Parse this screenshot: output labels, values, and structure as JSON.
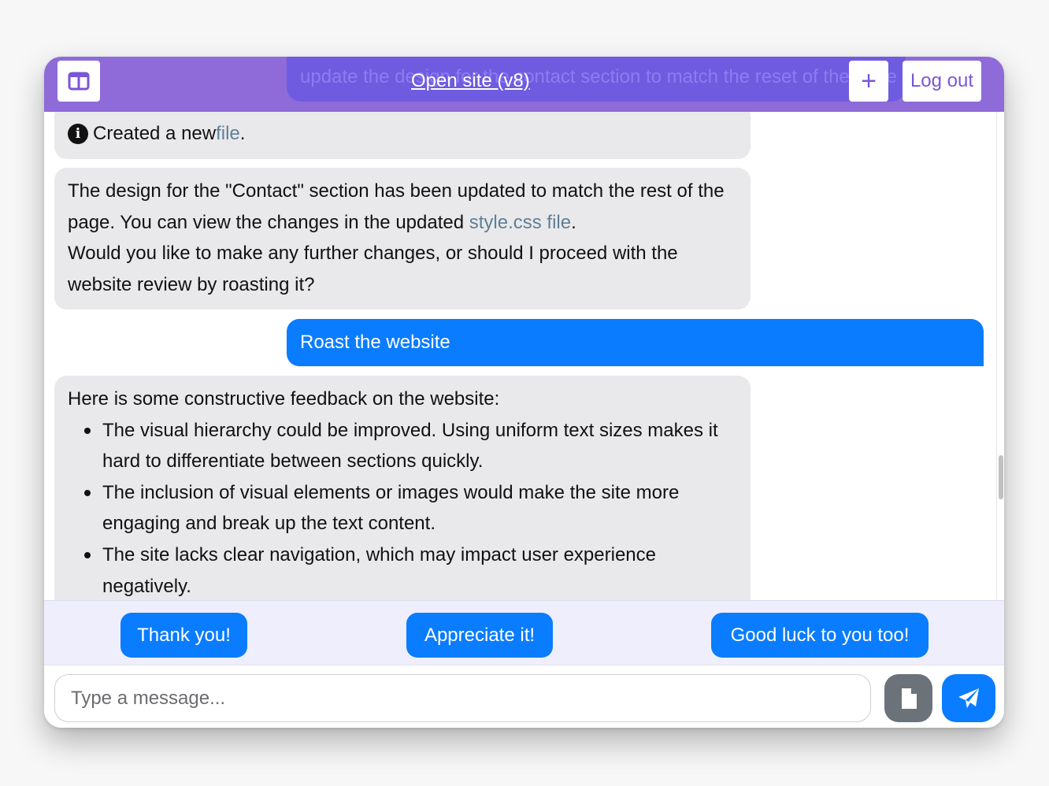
{
  "header": {
    "ticker_text": "update the design for the contact section to match the reset of the page",
    "open_site_label": "Open site (v8)",
    "new_label": "+",
    "logout_label": "Log out",
    "sidebar_icon": "sidebar-toggle-icon"
  },
  "messages": [
    {
      "type": "info",
      "icon": "info-icon",
      "text_before": "Created a new ",
      "link_text": "file",
      "text_after": "."
    },
    {
      "type": "assistant",
      "line1": "The design for the \"Contact\" section has been updated to match the rest of the page. You can view the changes in the updated ",
      "link_text": "style.css file",
      "line1_after": ".",
      "line2": "Would you like to make any further changes, or should I proceed with the website review by roasting it?"
    },
    {
      "type": "user",
      "text": "Roast the website"
    },
    {
      "type": "assistant",
      "intro": "Here is some constructive feedback on the website:",
      "bullets": [
        "The visual hierarchy could be improved. Using uniform text sizes makes it hard to differentiate between sections quickly.",
        "The inclusion of visual elements or images would make the site more engaging and break up the text content.",
        "The site lacks clear navigation, which may impact user experience negatively."
      ]
    }
  ],
  "suggestions": [
    "Thank you!",
    "Appreciate it!",
    "Good luck to you too!"
  ],
  "composer": {
    "placeholder": "Type a message...",
    "file_icon": "file-icon",
    "send_icon": "send-icon"
  },
  "colors": {
    "header_bg": "#8e6bd8",
    "accent_blue": "#0a7cff",
    "bubble_grey": "#e9e9eb",
    "link": "#5f7f95"
  }
}
